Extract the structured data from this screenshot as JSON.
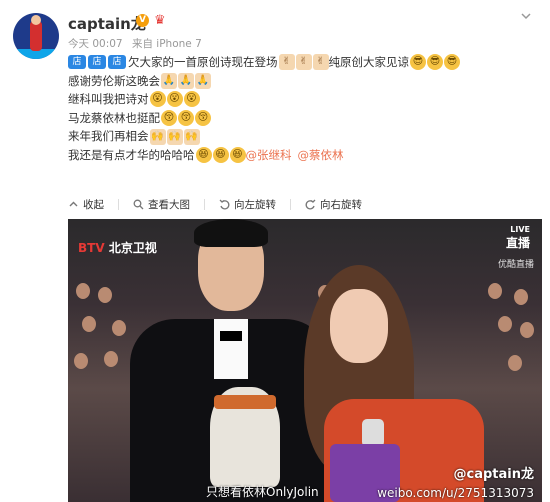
{
  "user": {
    "name": "captain龙",
    "verified_badge": "V"
  },
  "meta": {
    "time": "今天 00:07",
    "source": "来自 iPhone 7"
  },
  "post": {
    "tag": "店",
    "line1_text": "欠大家的一首原创诗现在登场",
    "line1_mid": "纯原创大家见谅",
    "line2": "感谢劳伦斯这晚会",
    "line3": "继科叫我把诗对",
    "line4": "马龙蔡依林也挺配",
    "line5": "来年我们再相会",
    "line6_text": "我还是有点才华的哈哈哈",
    "mention1": "@张继科",
    "mention2": "@蔡依林"
  },
  "toolbar": {
    "collapse": "收起",
    "view_large": "查看大图",
    "rotate_left": "向左旋转",
    "rotate_right": "向右旋转"
  },
  "photo": {
    "channel_prefix": "BTV",
    "channel_name": "北京卫视",
    "live_label": "直播",
    "live_tag": "LIVE",
    "youku": "优酷直播",
    "watermark_user": "@captain龙",
    "watermark_left": "只想看依林OnlyJolin",
    "watermark_url": "weibo.com/u/2751313073"
  },
  "colors": {
    "accent": "#2b87e3",
    "mention": "#eb7350"
  }
}
